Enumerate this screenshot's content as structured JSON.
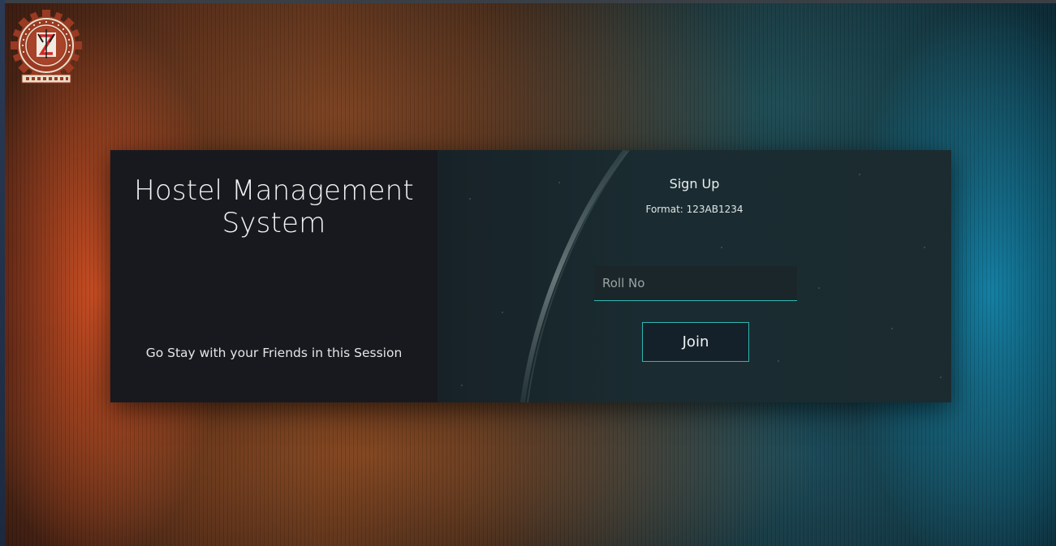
{
  "logo": {
    "ring_text_top": "NATIONAL INSTITUTE OF TECHNOLOGY",
    "ring_text_bottom": "ROURKELA",
    "colors": {
      "gear": "#9a3a22",
      "ring": "#e8e0cc",
      "accent": "#d62828"
    }
  },
  "card": {
    "left": {
      "title": "Hostel Management System",
      "tagline": "Go Stay with your Friends in this Session"
    },
    "right": {
      "heading": "Sign Up",
      "format_hint": "Format: 123AB1234",
      "roll_input": {
        "value": "",
        "placeholder": "Roll No"
      },
      "join_label": "Join"
    }
  },
  "colors": {
    "accent": "#2fb6b0",
    "left_panel": "#17191f",
    "right_panel": "#1a2c31",
    "bg_warm": "#e2562a",
    "bg_cool": "#148cb4"
  }
}
